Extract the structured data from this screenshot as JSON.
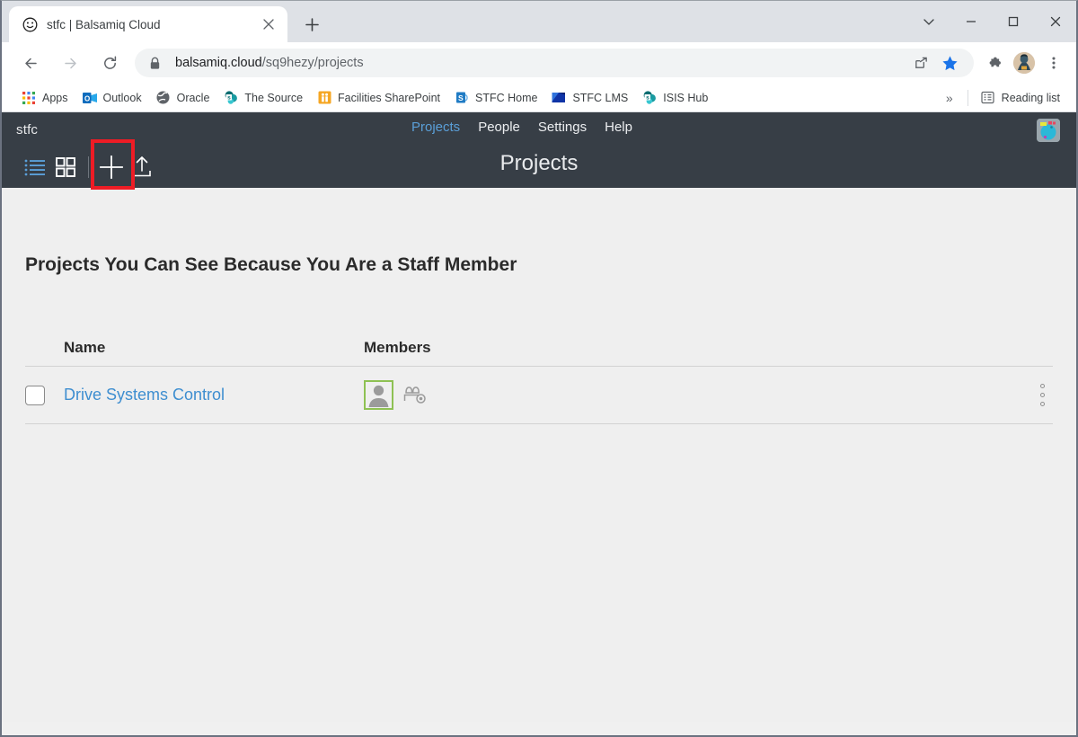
{
  "browser": {
    "tab": {
      "title": "stfc | Balsamiq Cloud",
      "favicon": "smiley-face-icon",
      "close": "×"
    },
    "new_tab_label": "+",
    "window_controls": {
      "minimize_chevron": "⌄",
      "minimize": "–",
      "maximize": "□",
      "close": "✕"
    },
    "nav": {
      "back": "←",
      "forward": "→",
      "reload": "⟳"
    },
    "omnibox": {
      "lock_icon": "lock-icon",
      "url_domain": "balsamiq.cloud",
      "url_path": "/sq9hezy/projects"
    },
    "omnibox_actions": [
      {
        "name": "share-icon",
        "glyph": "⇪"
      },
      {
        "name": "bookmark-star-icon",
        "glyph": "★",
        "color": "#1a73e8"
      }
    ],
    "toolbar_actions": [
      {
        "name": "extensions-puzzle-icon",
        "glyph": "🧩"
      },
      {
        "name": "profile-avatar",
        "glyph": ""
      },
      {
        "name": "chrome-menu-icon",
        "glyph": "⋮"
      }
    ],
    "bookmarks": [
      {
        "label": "Apps",
        "icon": "apps-grid-icon"
      },
      {
        "label": "Outlook",
        "icon": "outlook-icon"
      },
      {
        "label": "Oracle",
        "icon": "oracle-globe-icon"
      },
      {
        "label": "The Source",
        "icon": "sharepoint-icon"
      },
      {
        "label": "Facilities SharePoint",
        "icon": "facilities-icon"
      },
      {
        "label": "STFC Home",
        "icon": "sharepoint-icon"
      },
      {
        "label": "STFC LMS",
        "icon": "lms-icon"
      },
      {
        "label": "ISIS Hub",
        "icon": "isis-hub-icon"
      }
    ],
    "bookmarks_overflow": "»",
    "reading_list": {
      "label": "Reading list",
      "icon": "reading-list-icon"
    }
  },
  "app": {
    "brand": "stfc",
    "nav": [
      {
        "label": "Projects",
        "active": true
      },
      {
        "label": "People",
        "active": false
      },
      {
        "label": "Settings",
        "active": false
      },
      {
        "label": "Help",
        "active": false
      }
    ],
    "page_title": "Projects",
    "toolbar": [
      {
        "name": "list-view-icon",
        "active": true
      },
      {
        "name": "grid-view-icon",
        "active": false
      },
      {
        "name": "add-project-icon",
        "active": false,
        "highlighted": true
      },
      {
        "name": "upload-project-icon",
        "active": false
      }
    ],
    "highlight_color": "#ee1c25",
    "accent_color": "#5a9fd8",
    "header_bg": "#373e46"
  },
  "main": {
    "section_title": "Projects You Can See Because You Are a Staff Member",
    "table": {
      "columns": [
        "Name",
        "Members"
      ],
      "rows": [
        {
          "checked": false,
          "name": "Drive Systems Control",
          "member_avatar": "person-avatar-icon",
          "viewers_icon": "viewers-eye-icon",
          "menu": "row-overflow-menu"
        }
      ]
    }
  }
}
